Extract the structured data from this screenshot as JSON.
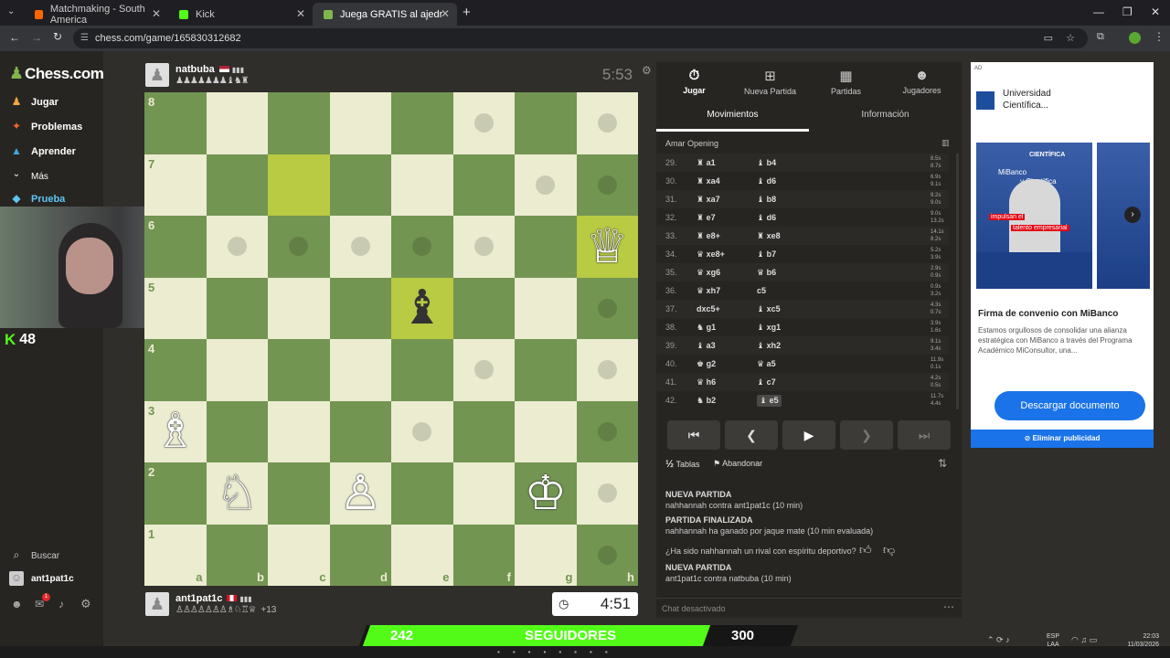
{
  "browser": {
    "tabs": [
      {
        "title": "Matchmaking - South America"
      },
      {
        "title": "Kick"
      },
      {
        "title": "Juega GRATIS al ajedrez online"
      }
    ],
    "url": "chess.com/game/165830312682"
  },
  "sidebar": {
    "logo": "Chess.com",
    "items": [
      {
        "label": "Jugar"
      },
      {
        "label": "Problemas"
      },
      {
        "label": "Aprender"
      },
      {
        "label": "Más"
      },
      {
        "label": "Prueba"
      }
    ],
    "search_label": "Buscar",
    "user_label": "ant1pat1c",
    "notif_count": "1"
  },
  "kick": {
    "count": "48"
  },
  "top_player": {
    "name": "natbuba",
    "time": "5:53",
    "caps": "♟♟♟♟♟♟♟♝♞♜"
  },
  "bottom_player": {
    "name": "ant1pat1c",
    "time": "4:51",
    "caps": "♙♙♙♙♙♙♙♗♘♖♕",
    "adv": "+13"
  },
  "board": {
    "ranks": [
      "8",
      "7",
      "6",
      "5",
      "4",
      "3",
      "2",
      "1"
    ],
    "files": [
      "a",
      "b",
      "c",
      "d",
      "e",
      "f",
      "g",
      "h"
    ]
  },
  "panel": {
    "tabs": [
      {
        "label": "Jugar",
        "icon": "stopwatch-icon"
      },
      {
        "label": "Nueva Partida",
        "icon": "plus-icon"
      },
      {
        "label": "Partidas",
        "icon": "grid-icon"
      },
      {
        "label": "Jugadores",
        "icon": "players-icon"
      }
    ],
    "subtabs": [
      "Movimientos",
      "Información"
    ],
    "opening": "Amar Opening",
    "moves": [
      {
        "n": "29.",
        "w": "♜ a1",
        "b": "♝ b4",
        "t1": "8.5s",
        "t2": "8.7s"
      },
      {
        "n": "30.",
        "w": "♜ xa4",
        "b": "♝ d6",
        "t1": "6.9s",
        "t2": "9.1s"
      },
      {
        "n": "31.",
        "w": "♜ xa7",
        "b": "♝ b8",
        "t1": "9.2s",
        "t2": "9.0s"
      },
      {
        "n": "32.",
        "w": "♜ e7",
        "b": "♝ d6",
        "t1": "9.0s",
        "t2": "13.2s"
      },
      {
        "n": "33.",
        "w": "♜ e8+",
        "b": "♜ xe8",
        "t1": "14.1s",
        "t2": "8.2s"
      },
      {
        "n": "34.",
        "w": "♛ xe8+",
        "b": "♝ b7",
        "t1": "5.2s",
        "t2": "3.9s"
      },
      {
        "n": "35.",
        "w": "♛ xg6",
        "b": "♛ b6",
        "t1": "2.9s",
        "t2": "0.9s"
      },
      {
        "n": "36.",
        "w": "♛ xh7",
        "b": "c5",
        "t1": "0.9s",
        "t2": "3.2s"
      },
      {
        "n": "37.",
        "w": "dxc5+",
        "b": "♝ xc5",
        "t1": "4.3s",
        "t2": "0.7s"
      },
      {
        "n": "38.",
        "w": "♞ g1",
        "b": "♝ xg1",
        "t1": "3.9s",
        "t2": "1.6s"
      },
      {
        "n": "39.",
        "w": "♝ a3",
        "b": "♝ xh2",
        "t1": "9.1s",
        "t2": "3.4s"
      },
      {
        "n": "40.",
        "w": "♚ g2",
        "b": "♛ a5",
        "t1": "11.9s",
        "t2": "0.1s"
      },
      {
        "n": "41.",
        "w": "♛ h6",
        "b": "♝ c7",
        "t1": "4.2s",
        "t2": "0.5s"
      },
      {
        "n": "42.",
        "w": "♞ b2",
        "b": "♝ e5",
        "t1": "11.7s",
        "t2": "4.4s"
      }
    ],
    "draw_label": "Tablas",
    "resign_label": "Abandonar",
    "chat": [
      {
        "head": "NUEVA PARTIDA",
        "line": "nahhannah contra ant1pat1c (10 min)"
      },
      {
        "head": "PARTIDA FINALIZADA",
        "line": "nahhannah ha ganado por jaque mate (10 min evaluada)"
      },
      {
        "question": "¿Ha sido nahhannah un rival con espíritu deportivo?"
      },
      {
        "head": "NUEVA PARTIDA",
        "line": "ant1pat1c contra natbuba (10 min)"
      }
    ],
    "chat_disabled": "Chat desactivado"
  },
  "ad": {
    "label": "AD",
    "brand": "Universidad Científica...",
    "img_title": "CIENTÍFICA",
    "img_line1": "MiBanco",
    "img_line2": "y Científica",
    "img_line3": "impulsan el",
    "img_line4": "talento empresarial",
    "title": "Firma de convenio con MiBanco",
    "body": "Estamos orgullosos de consolidar una alianza estratégica con MiBanco a través del Programa Académico MiConsultor, una...",
    "cta": "Descargar documento",
    "remove": "Eliminar publicidad"
  },
  "banner": {
    "left": "242",
    "center": "SEGUIDORES",
    "right": "300"
  },
  "taskbar": {
    "lang1": "ESP",
    "lang2": "LAA",
    "time": "22:03",
    "date": "11/03/2026"
  }
}
